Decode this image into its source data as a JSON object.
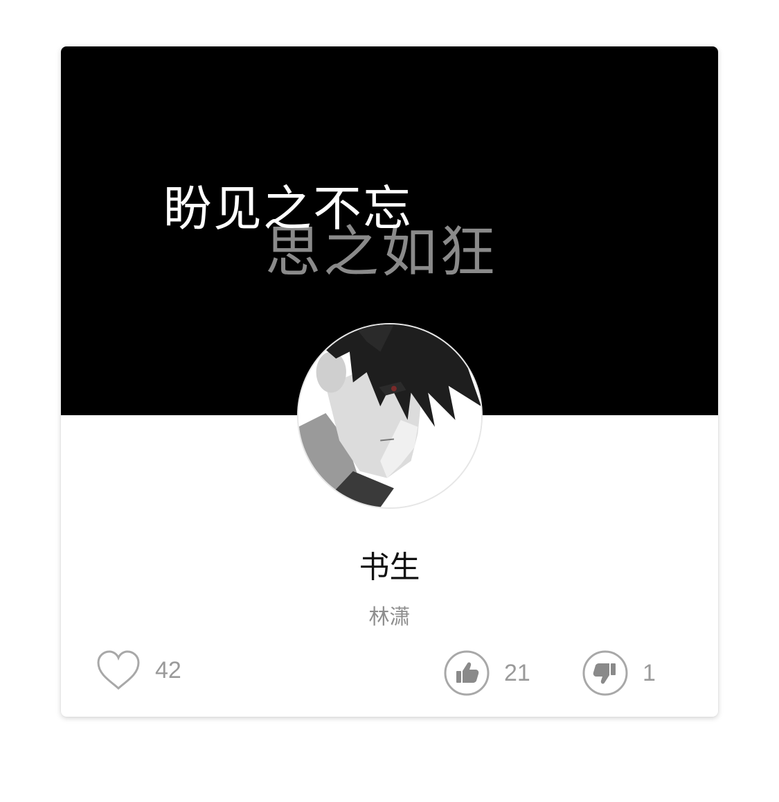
{
  "cover": {
    "line1": "盼见之不忘",
    "line2": "思之如狂"
  },
  "avatar": {
    "icon": "anime-boy-avatar"
  },
  "post": {
    "title": "书生",
    "author": "林潇"
  },
  "stats": {
    "likes": "42",
    "upvotes": "21",
    "downvotes": "1"
  },
  "colors": {
    "cover_bg": "#000000",
    "count_text": "#9a9a9a",
    "icon_stroke": "#a8a8a8"
  }
}
